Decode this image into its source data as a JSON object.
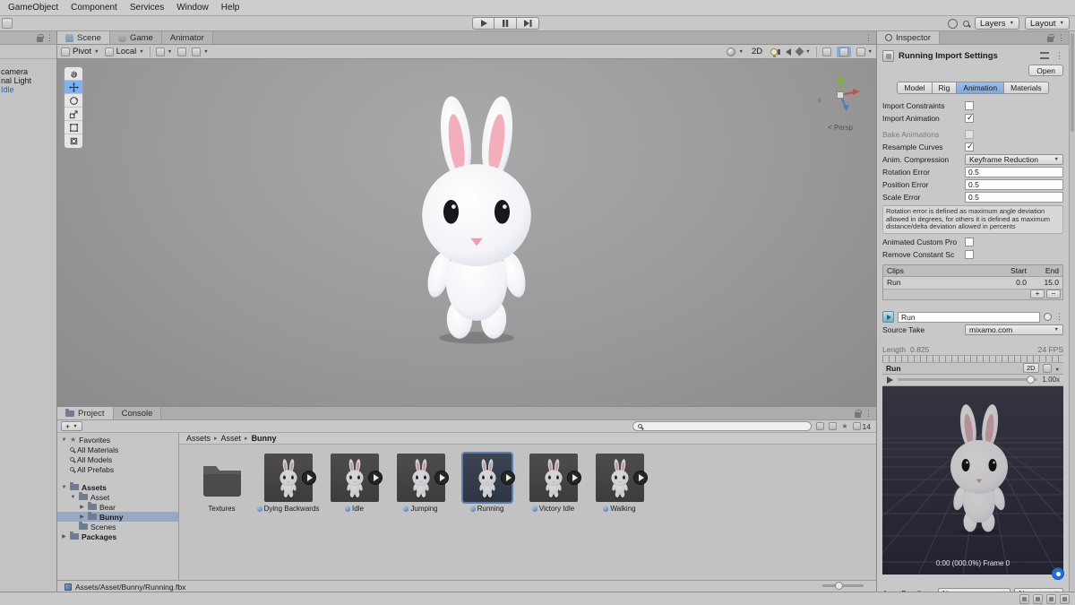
{
  "menubar": {
    "items": [
      "GameObject",
      "Component",
      "Services",
      "Window",
      "Help"
    ]
  },
  "topbar": {
    "layers": "Layers",
    "layout": "Layout"
  },
  "hierarchy": {
    "items": [
      {
        "label": "camera",
        "style": "normal"
      },
      {
        "label": "nal Light",
        "style": "normal"
      },
      {
        "label": "Idle",
        "style": "prefab-blue"
      }
    ]
  },
  "scene": {
    "tabs": [
      {
        "label": "Scene"
      },
      {
        "label": "Game"
      },
      {
        "label": "Animator"
      }
    ],
    "toolbar": {
      "pivot": "Pivot",
      "local": "Local",
      "mode2d": "2D"
    },
    "gizmo_label": "< Persp"
  },
  "inspector": {
    "tab": "Inspector",
    "title": "Running Import Settings",
    "open_button": "Open",
    "tabs": [
      "Model",
      "Rig",
      "Animation",
      "Materials"
    ],
    "active_tab": "Animation",
    "rows": {
      "import_constraints": "Import Constraints",
      "import_animation": "Import Animation",
      "bake_animations": "Bake Animations",
      "resample_curves": "Resample Curves",
      "anim_compression_label": "Anim. Compression",
      "anim_compression_value": "Keyframe Reduction",
      "rotation_error_label": "Rotation Error",
      "rotation_error_value": "0.5",
      "position_error_label": "Position Error",
      "position_error_value": "0.5",
      "scale_error_label": "Scale Error",
      "scale_error_value": "0.5",
      "animated_custom": "Animated Custom Pro",
      "remove_constant": "Remove Constant Sc"
    },
    "checkbox_states": {
      "import_constraints": false,
      "import_animation": true,
      "bake_animations": false,
      "resample_curves": true,
      "animated_custom": false,
      "remove_constant": false
    },
    "help_text": "Rotation error is defined as maximum angle deviation allowed in degrees, for others it is defined as maximum distance/delta deviation allowed in percents",
    "clips": {
      "col_clips": "Clips",
      "col_start": "Start",
      "col_end": "End",
      "row_name": "Run",
      "row_start": "0.0",
      "row_end": "15.0",
      "add": "+",
      "remove": "−"
    },
    "clip": {
      "name": "Run",
      "source_take_label": "Source Take",
      "source_take_value": "mixamo.com",
      "length_label": "Length",
      "length_value": "0.825",
      "fps": "24 FPS"
    },
    "preview": {
      "clip_name": "Run",
      "mode2d": "2D",
      "speed": "1.00x",
      "status": "0:00 (000.0%) Frame 0"
    },
    "assetbundle": {
      "label": "AssetBundle",
      "value1": "None",
      "value2": "None"
    }
  },
  "project": {
    "tabs": [
      {
        "label": "Project"
      },
      {
        "label": "Console"
      }
    ],
    "create_button": "+",
    "count_badge": "14",
    "tree": [
      {
        "label": "Favorites"
      },
      {
        "label": "All Materials"
      },
      {
        "label": "All Models"
      },
      {
        "label": "All Prefabs"
      },
      {
        "label": "Assets"
      },
      {
        "label": "Asset"
      },
      {
        "label": "Bear"
      },
      {
        "label": "Bunny",
        "selected": true
      },
      {
        "label": "Scenes"
      },
      {
        "label": "Packages"
      }
    ],
    "breadcrumb": [
      "Assets",
      "Asset",
      "Bunny"
    ],
    "items": [
      {
        "label": "Textures",
        "type": "folder"
      },
      {
        "label": "Dying Backwards",
        "type": "anim"
      },
      {
        "label": "Idle",
        "type": "anim"
      },
      {
        "label": "Jumping",
        "type": "anim"
      },
      {
        "label": "Running",
        "type": "anim",
        "selected": true
      },
      {
        "label": "Victory Idle",
        "type": "anim"
      },
      {
        "label": "Walking",
        "type": "anim"
      }
    ],
    "status_path": "Assets/Asset/Bunny/Running.fbx"
  }
}
